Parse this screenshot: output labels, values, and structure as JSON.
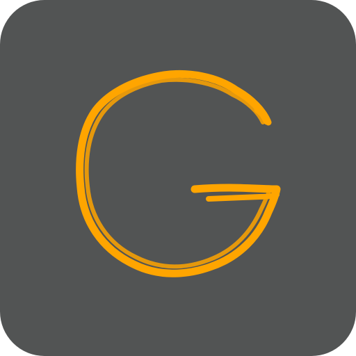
{
  "icon": {
    "name": "app-icon",
    "glyph": "G",
    "glyph_style": "hand-drawn",
    "colors": {
      "tile": "#525454",
      "glyph": "#ffa500"
    }
  }
}
